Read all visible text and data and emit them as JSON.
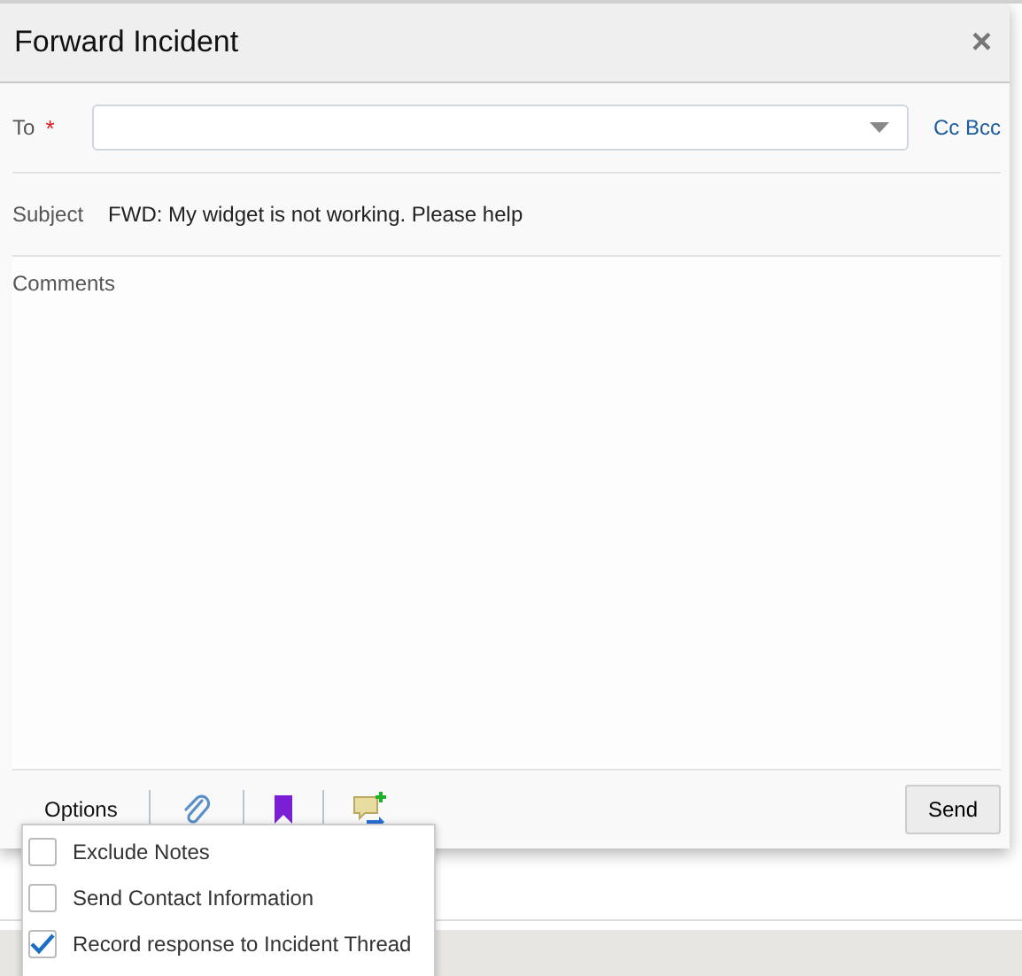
{
  "dialog": {
    "title": "Forward Incident",
    "close": "×"
  },
  "to": {
    "label": "To",
    "required": "*",
    "cc_bcc": "Cc Bcc"
  },
  "subject": {
    "label": "Subject",
    "value": "FWD: My widget is not working. Please help"
  },
  "comments": {
    "placeholder": "Comments"
  },
  "toolbar": {
    "options": "Options",
    "send": "Send"
  },
  "options_menu": [
    {
      "label": "Exclude Notes",
      "checked": false
    },
    {
      "label": "Send Contact Information",
      "checked": false
    },
    {
      "label": "Record response to Incident Thread",
      "checked": true
    }
  ]
}
